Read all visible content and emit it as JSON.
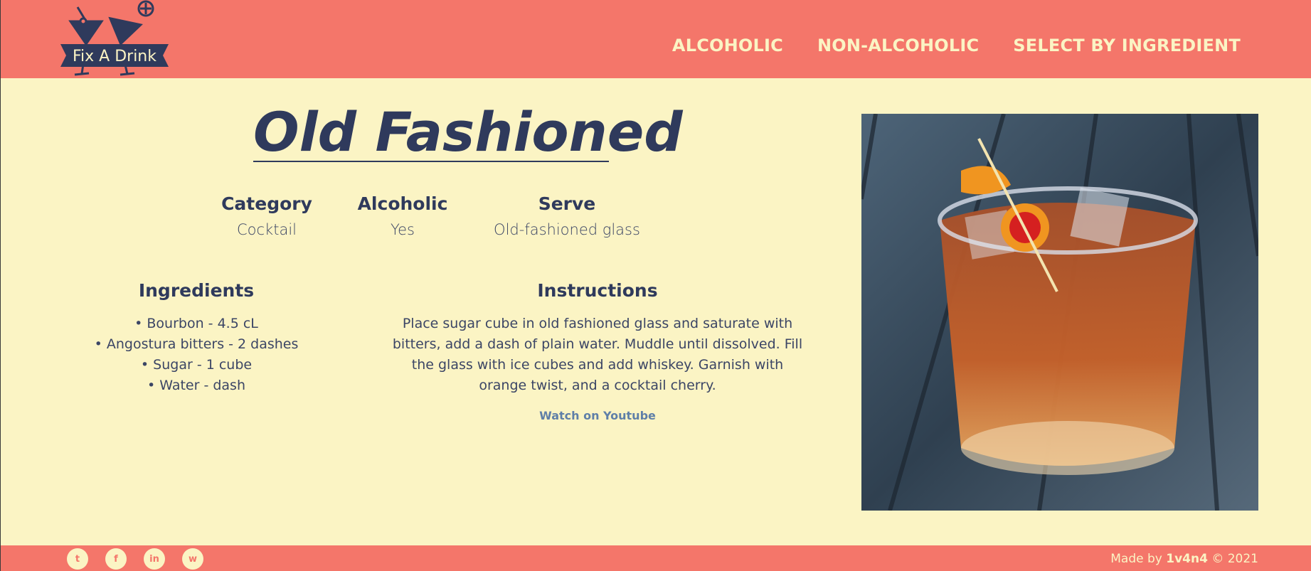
{
  "brand": {
    "name": "Fix A Drink"
  },
  "nav": {
    "items": [
      {
        "label": "ALCOHOLIC"
      },
      {
        "label": "NON-ALCOHOLIC"
      },
      {
        "label": "SELECT BY INGREDIENT"
      }
    ]
  },
  "drink": {
    "title": "Old Fashioned",
    "meta": [
      {
        "heading": "Category",
        "value": "Cocktail"
      },
      {
        "heading": "Alcoholic",
        "value": "Yes"
      },
      {
        "heading": "Serve",
        "value": "Old-fashioned glass"
      }
    ],
    "ingredients_heading": "Ingredients",
    "ingredients": [
      "Bourbon - 4.5 cL",
      "Angostura bitters - 2 dashes",
      "Sugar - 1 cube",
      "Water - dash"
    ],
    "instructions_heading": "Instructions",
    "instructions": "Place sugar cube in old fashioned glass and saturate with bitters, add a dash of plain water. Muddle until dissolved. Fill the glass with ice cubes and add whiskey.  Garnish with orange twist, and a cocktail cherry.",
    "video_link": "Watch on Youtube"
  },
  "footer": {
    "socials": [
      {
        "icon": "twitter-icon",
        "glyph": "t"
      },
      {
        "icon": "facebook-icon",
        "glyph": "f"
      },
      {
        "icon": "linkedin-icon",
        "glyph": "in"
      },
      {
        "icon": "whatsapp-icon",
        "glyph": "w"
      }
    ],
    "credit_prefix": "Made by ",
    "credit_author": "1v4n4",
    "credit_suffix": " © 2021"
  },
  "colors": {
    "header_bg": "#f4766a",
    "page_bg": "#fbf4c4",
    "text_dark": "#2f3a5c",
    "link": "#5f7fa8"
  }
}
